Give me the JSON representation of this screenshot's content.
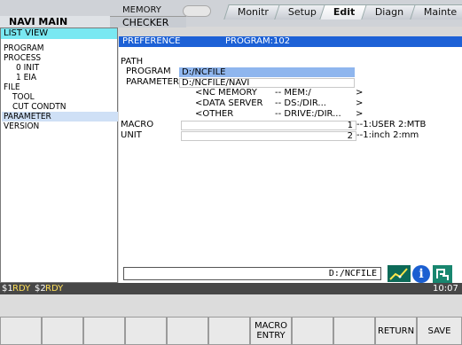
{
  "mode": "MEMORY",
  "tabs": [
    "Monitr",
    "Setup",
    "Edit",
    "Diagn",
    "Mainte"
  ],
  "active_tab": "Edit",
  "subtabs": [
    "NAVI MAIN",
    "CHECKER"
  ],
  "left_panel": {
    "header": "LIST VIEW",
    "items": [
      "PROGRAM",
      "PROCESS",
      "0 INIT",
      "1 EIA",
      "FILE",
      "TOOL",
      "CUT CONDTN",
      "PARAMETER",
      "VERSION"
    ],
    "selected": "PARAMETER"
  },
  "preference": {
    "header": "PREFERENCE",
    "program_label": "PROGRAM:102",
    "path_label": "PATH",
    "program_field_label": "PROGRAM",
    "program_value": "D:/NCFILE",
    "parameter_field_label": "PARAMETER",
    "parameter_value": "D:/NCFILE/NAVI",
    "hints": [
      {
        "a": "<NC MEMORY",
        "b": "-- MEM:/",
        "c": ">"
      },
      {
        "a": "<DATA SERVER",
        "b": "-- DS:/DIR...",
        "c": ">"
      },
      {
        "a": "<OTHER",
        "b": "-- DRIVE:/DIR...",
        "c": ">"
      }
    ],
    "macro_label": "MACRO",
    "macro_value": "1",
    "macro_hint": "--1:USER 2:MTB",
    "unit_label": "UNIT",
    "unit_value": "2",
    "unit_hint": "--1:inch 2:mm"
  },
  "command_input": "D:/NCFILE",
  "icons": [
    "chart-icon",
    "info-icon",
    "guide-icon"
  ],
  "status": {
    "s1": "$1",
    "s1_state": "RDY",
    "s2": "$2",
    "s2_state": "RDY",
    "time": "10:07"
  },
  "softkeys": [
    "",
    "",
    "",
    "",
    "",
    "",
    "MACRO\nENTRY",
    "",
    "",
    "RETURN",
    "SAVE"
  ],
  "colors": {
    "header_blue": "#1d61d6",
    "list_header_cyan": "#79e8f2",
    "selection": "#8fb6ee",
    "status_bar": "#474747"
  }
}
